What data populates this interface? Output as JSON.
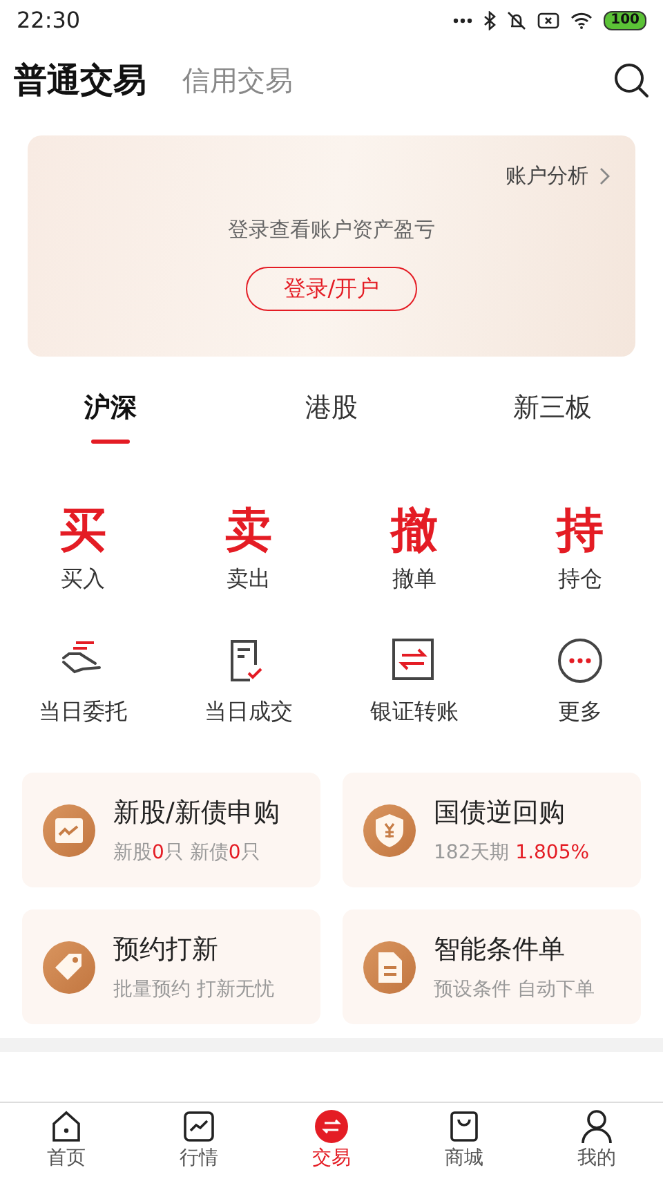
{
  "status_bar": {
    "time": "22:30",
    "battery": "100"
  },
  "header": {
    "tabs": [
      {
        "label": "普通交易",
        "selected": true
      },
      {
        "label": "信用交易",
        "selected": false
      }
    ]
  },
  "account_card": {
    "link": "账户分析",
    "prompt": "登录查看账户资产盈亏",
    "button": "登录/开户"
  },
  "market_tabs": [
    {
      "label": "沪深",
      "selected": true
    },
    {
      "label": "港股",
      "selected": false
    },
    {
      "label": "新三板",
      "selected": false
    }
  ],
  "quick_actions": [
    {
      "glyph": "买",
      "label": "买入"
    },
    {
      "glyph": "卖",
      "label": "卖出"
    },
    {
      "glyph": "撤",
      "label": "撤单"
    },
    {
      "glyph": "持",
      "label": "持仓"
    }
  ],
  "tools": [
    {
      "kind": "entrust",
      "label": "当日委托"
    },
    {
      "kind": "deal",
      "label": "当日成交"
    },
    {
      "kind": "transfer",
      "label": "银证转账"
    },
    {
      "kind": "more",
      "label": "更多"
    }
  ],
  "features": [
    {
      "kind": "chart",
      "title": "新股/新债申购",
      "subtitle": "新股**0**只 新债**0**只"
    },
    {
      "kind": "shield",
      "title": "国债逆回购",
      "subtitle": "182天期 **1.805%**"
    },
    {
      "kind": "tag",
      "title": "预约打新",
      "subtitle": "批量预约 打新无忧"
    },
    {
      "kind": "doc",
      "title": "智能条件单",
      "subtitle": "预设条件 自动下单"
    }
  ],
  "bottom_nav": [
    {
      "kind": "home",
      "label": "首页",
      "selected": false
    },
    {
      "kind": "market",
      "label": "行情",
      "selected": false
    },
    {
      "kind": "trade",
      "label": "交易",
      "selected": true
    },
    {
      "kind": "mall",
      "label": "商城",
      "selected": false
    },
    {
      "kind": "me",
      "label": "我的",
      "selected": false
    }
  ]
}
